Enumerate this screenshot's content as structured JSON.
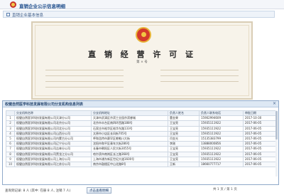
{
  "app": {
    "title": "直销企业公示信息明细"
  },
  "breadcrumb": {
    "label": "直销企业基本信息"
  },
  "certificate": {
    "title": "直 销 经 营 许 可 证",
    "number_label": "第 × 号"
  },
  "dialog": {
    "title": "权健自然医学科技发展有限公司分支机构信息列表",
    "close_label": "×",
    "columns": [
      "分支机构名称",
      "分支机构地址",
      "负责人姓名",
      "负责人联系电话",
      "审批日期"
    ],
    "rows": [
      [
        "1",
        "权健自然医学科技发展有限公司天津分公司",
        "天津市武清区京滨工业园京滨睿城",
        "董金果",
        "15902994609",
        "2017-10-30"
      ],
      [
        "2",
        "权健自然医学科技发展有限公司北京分公司",
        "北京市丰台区南四环西路188号",
        "王宝亮",
        "15935111922",
        "2017-06-05"
      ],
      [
        "3",
        "权健自然医学科技发展有限公司河北分公司",
        "石家庄市裕华区裕华东路133号",
        "王宝亮",
        "15935111922",
        "2017-06-05"
      ],
      [
        "4",
        "权健自然医学科技发展有限公司山西分公司",
        "太原市小店区长风街705号",
        "王宝亮",
        "15935111922",
        "2017-06-05"
      ],
      [
        "5",
        "权健自然医学科技发展有限公司内蒙古分公司",
        "呼和浩特市赛罕区敕勒川大街",
        "闫金光",
        "15135383799",
        "2017-06-05"
      ],
      [
        "6",
        "权健自然医学科技发展有限公司辽宁分公司",
        "沈阳市和平区青年大街286号",
        "李刚",
        "13888000856",
        "2017-06-05"
      ],
      [
        "7",
        "权健自然医学科技发展有限公司吉林分公司",
        "长春市朝阳区人民大街3055号",
        "王宝亮",
        "15935111922",
        "2017-06-05"
      ],
      [
        "8",
        "权健自然医学科技发展有限公司黑龙江分公司",
        "哈尔滨市南岗区长江路368号",
        "王宝亮",
        "15935111922",
        "2017-06-05"
      ],
      [
        "9",
        "权健自然医学科技发展有限公司上海分公司",
        "上海市浦东新区世纪大道1600号",
        "王宝亮",
        "15935111922",
        "2017-06-05"
      ],
      [
        "10",
        "权健自然医学科技发展有限公司江苏分公司",
        "南京市鼓楼区中山北路8号",
        "王新",
        "18660777717",
        "2017-06-05"
      ]
    ]
  },
  "pager": {
    "info": "查询到记录: 8 人 (其中: 在册 8 人, 注销 7 人)",
    "button_label": "点击查看明细",
    "count_text": "共 1 页 / 第 1 页"
  },
  "colors": {
    "accent": "#1f4e8c",
    "emblem": "#d43a2c",
    "gold": "#e8b437"
  }
}
